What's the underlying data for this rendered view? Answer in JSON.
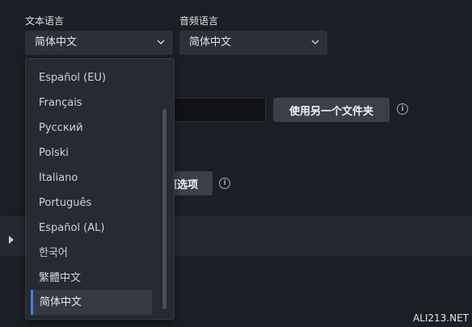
{
  "text_language": {
    "label": "文本语言",
    "value": "简体中文",
    "options": [
      "Español (EU)",
      "Français",
      "Русский",
      "Polski",
      "Italiano",
      "Português",
      "Español (AL)",
      "한국어",
      "繁體中文",
      "简体中文"
    ],
    "selected_index": 9
  },
  "audio_language": {
    "label": "音频语言",
    "value": "简体中文"
  },
  "folder": {
    "use_other_folder_label": "使用另一个文件夹"
  },
  "options_button": {
    "label_partial": "项选项"
  },
  "icons": {
    "chevron": "chevron-down-icon",
    "info": "info-icon",
    "expand": "caret-right-icon"
  },
  "colors": {
    "accent": "#3f7fe0",
    "background": "#1b1e24",
    "control": "#2c3038"
  },
  "watermark": "ALI213.NET"
}
